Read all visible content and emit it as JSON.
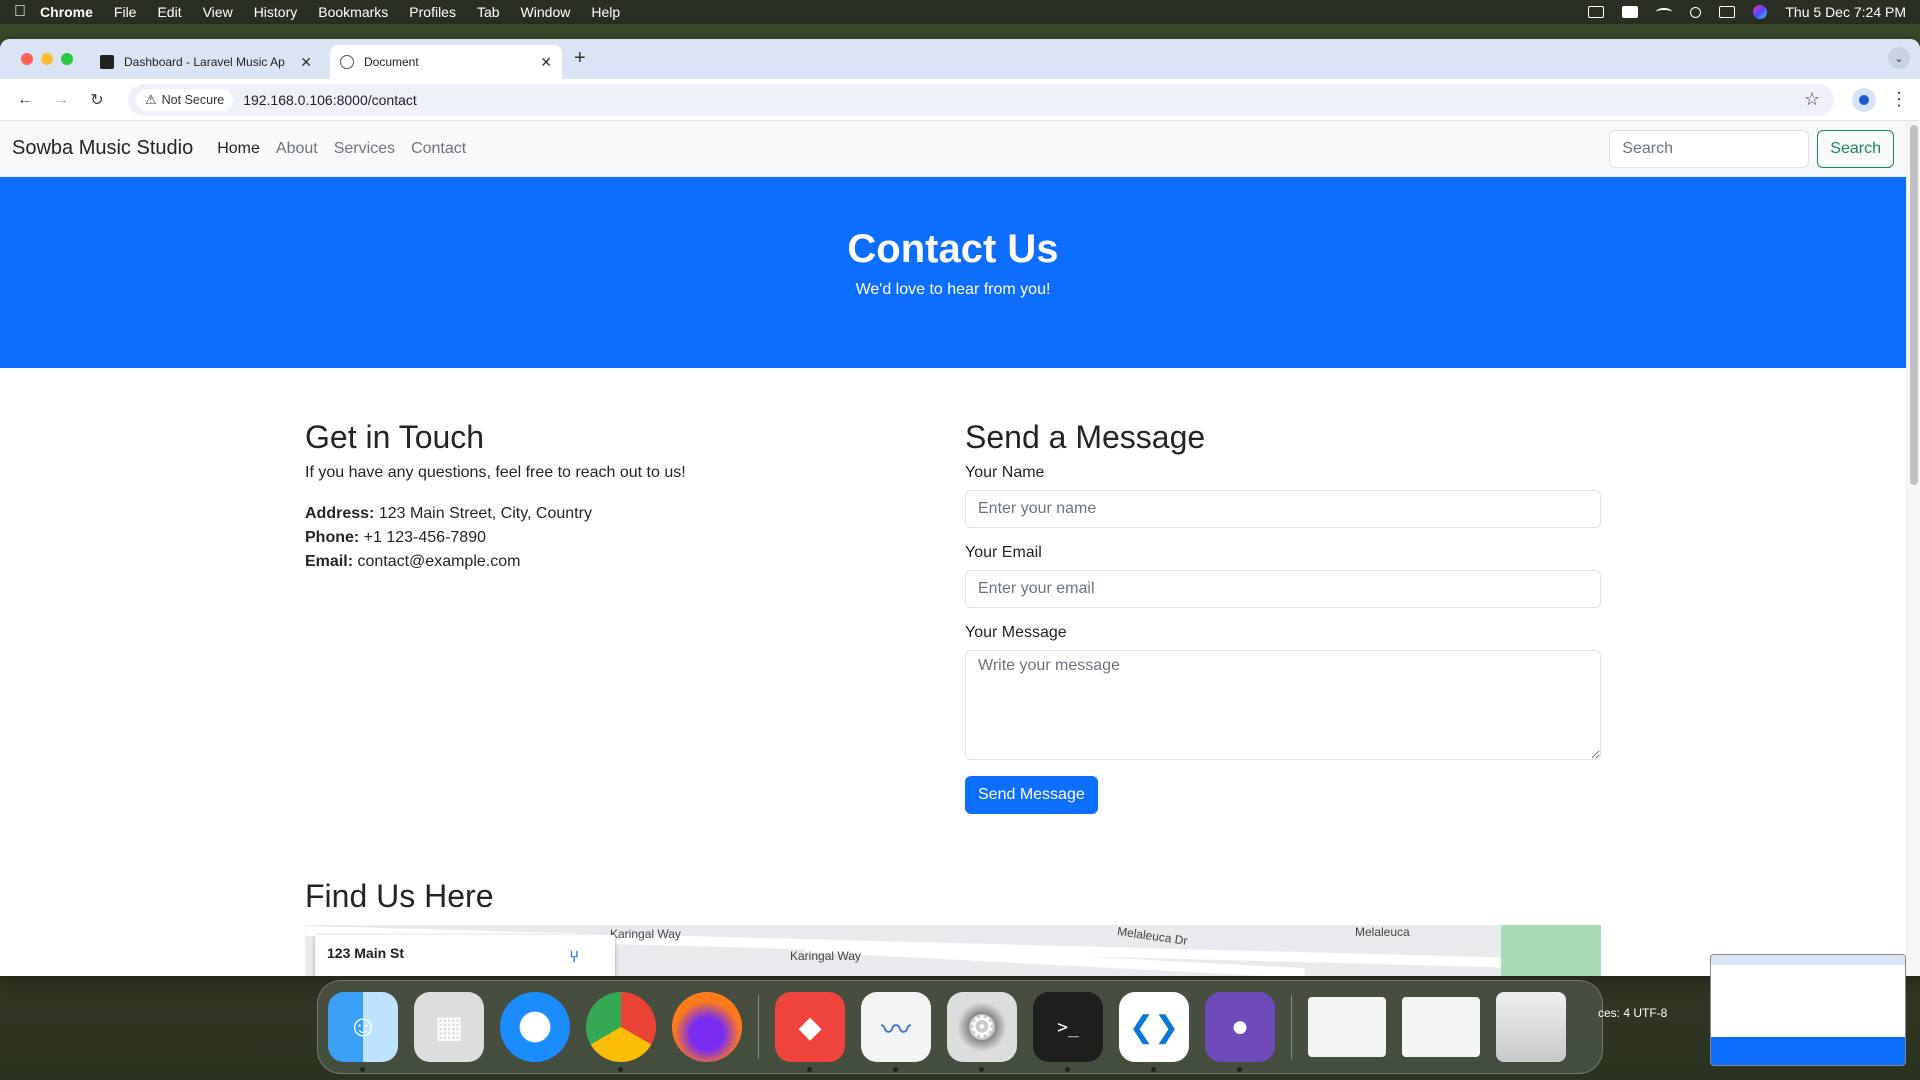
{
  "menubar": {
    "app_name": "Chrome",
    "menus": [
      "File",
      "Edit",
      "View",
      "History",
      "Bookmarks",
      "Profiles",
      "Tab",
      "Window",
      "Help"
    ],
    "clock": "Thu 5 Dec  7:24 PM"
  },
  "browser": {
    "tabs": [
      {
        "title": "Dashboard - Laravel Music Ap"
      },
      {
        "title": "Document"
      }
    ],
    "security_label": "Not Secure",
    "url": "192.168.0.106:8000/contact"
  },
  "site": {
    "brand": "Sowba Music Studio",
    "nav": [
      "Home",
      "About",
      "Services",
      "Contact"
    ],
    "search_placeholder": "Search",
    "search_button": "Search"
  },
  "hero": {
    "title": "Contact Us",
    "subtitle": "We'd love to hear from you!"
  },
  "touch": {
    "title": "Get in Touch",
    "intro": "If you have any questions, feel free to reach out to us!",
    "address_label": "Address:",
    "address": "123 Main Street, City, Country",
    "phone_label": "Phone:",
    "phone": "+1 123-456-7890",
    "email_label": "Email:",
    "email": "contact@example.com"
  },
  "form": {
    "title": "Send a Message",
    "name_label": "Your Name",
    "name_placeholder": "Enter your name",
    "email_label": "Your Email",
    "email_placeholder": "Enter your email",
    "message_label": "Your Message",
    "message_placeholder": "Write your message",
    "submit": "Send Message"
  },
  "map": {
    "title": "Find Us Here",
    "card_title": "123 Main St",
    "streets": [
      "Karingal Way",
      "Karingal Way",
      "Melaleuca Dr",
      "Melaleuca"
    ]
  },
  "dock": {
    "apps": [
      "finder",
      "launchpad",
      "safari",
      "chrome",
      "firefox",
      "anydesk",
      "freeform",
      "system-settings",
      "terminal",
      "vscode",
      "github-desktop",
      "trash"
    ]
  },
  "side_strip": "ces: 4   UTF-8"
}
